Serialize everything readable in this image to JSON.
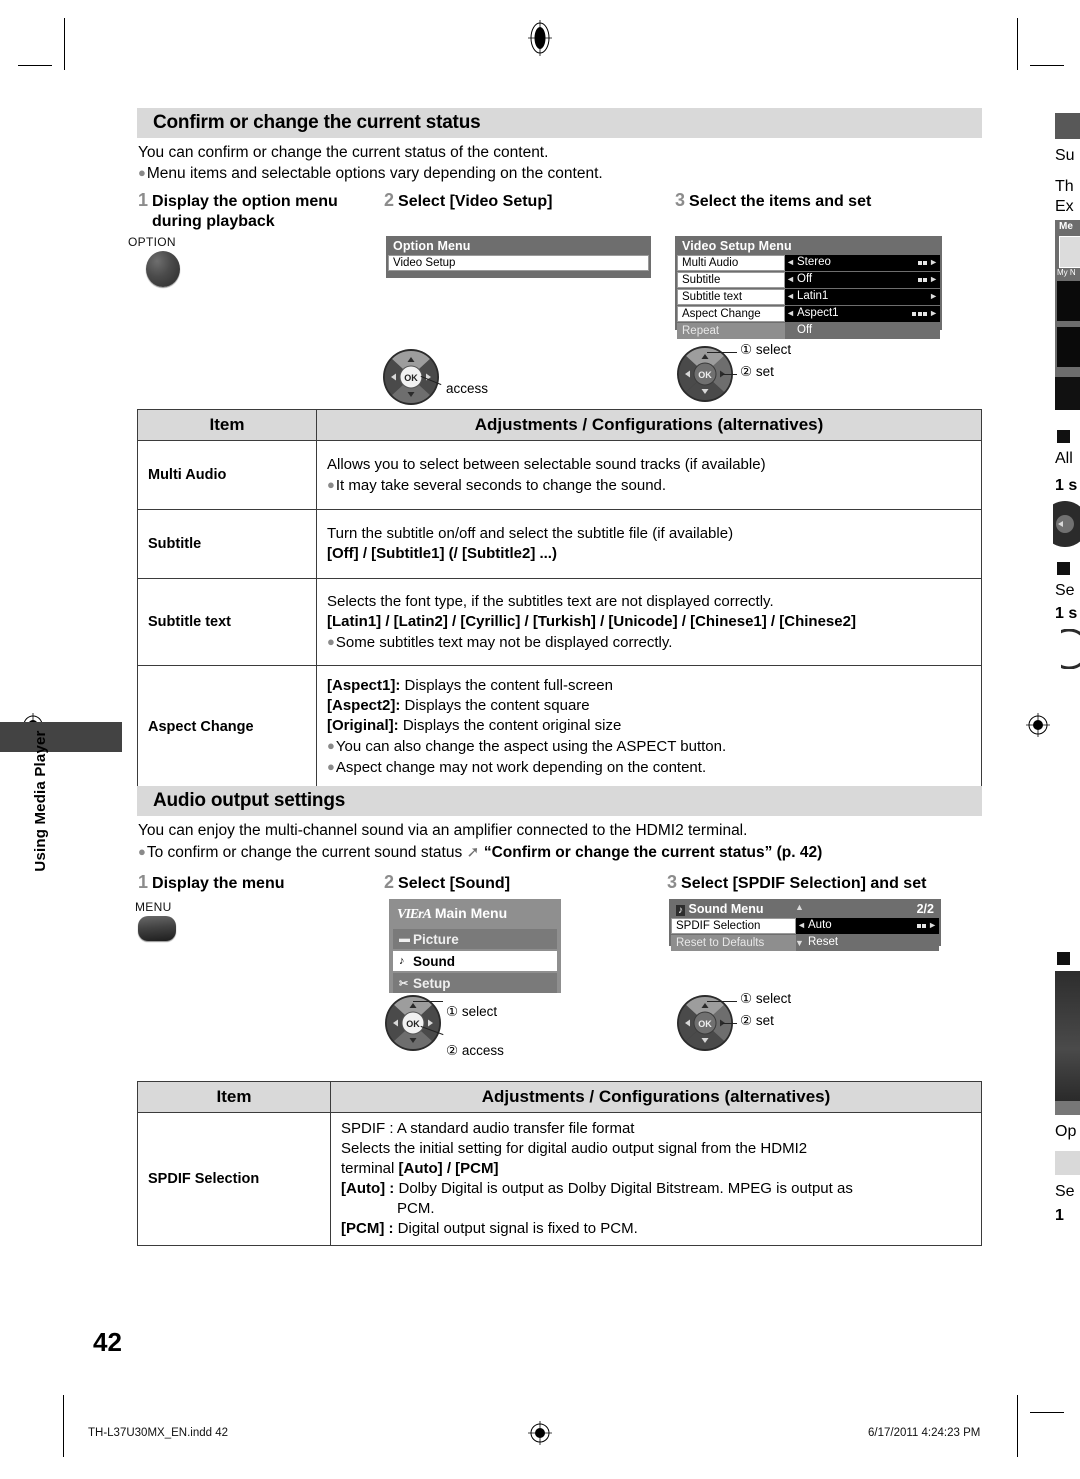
{
  "page": {
    "number": "42",
    "side_tab_label": "Using Media Player",
    "footer": {
      "file": "TH-L37U30MX_EN.indd   42",
      "timestamp": "6/17/2011   4:24:23 PM"
    }
  },
  "section1": {
    "heading": "Confirm or change the current status",
    "intro": "You can confirm or change the current status of the content.",
    "intro_bullet": "Menu items and selectable options vary depending on the content.",
    "steps": [
      {
        "num": "1",
        "line1": "Display the option menu",
        "line2": "during playback"
      },
      {
        "num": "2",
        "line1": "Select [Video Setup]",
        "line2": ""
      },
      {
        "num": "3",
        "line1": "Select the items and set",
        "line2": ""
      }
    ],
    "option_button_label": "OPTION",
    "option_menu": {
      "title": "Option Menu",
      "items": [
        "Video Setup"
      ]
    },
    "video_setup_menu": {
      "title": "Video Setup Menu",
      "rows": [
        {
          "label": "Multi Audio",
          "value": "Stereo",
          "level": 2,
          "dim": false
        },
        {
          "label": "Subtitle",
          "value": "Off",
          "level": 2,
          "dim": false
        },
        {
          "label": "Subtitle text",
          "value": "Latin1",
          "level": 0,
          "dim": false
        },
        {
          "label": "Aspect Change",
          "value": "Aspect1",
          "level": 3,
          "dim": false
        },
        {
          "label": "Repeat",
          "value": "Off",
          "level": 0,
          "dim": true
        }
      ]
    },
    "navpad_left_callouts": [
      "access"
    ],
    "navpad_right_callouts": [
      "① select",
      "② set"
    ]
  },
  "table1": {
    "headers": [
      "Item",
      "Adjustments / Configurations (alternatives)"
    ],
    "rows": [
      {
        "item": "Multi Audio",
        "lines": [
          {
            "text": "Allows you to select between selectable sound tracks (if available)",
            "bold": false,
            "bullet": false
          },
          {
            "text": "It may take several seconds to change the sound.",
            "bold": false,
            "bullet": true
          }
        ]
      },
      {
        "item": "Subtitle",
        "lines": [
          {
            "text": "Turn the subtitle on/off and select the subtitle file (if available)",
            "bold": false,
            "bullet": false
          },
          {
            "text": "[Off] / [Subtitle1] (/ [Subtitle2] ...)",
            "bold": true,
            "bullet": false
          }
        ]
      },
      {
        "item": "Subtitle text",
        "lines": [
          {
            "text": "Selects the font type, if the subtitles text are not displayed correctly.",
            "bold": false,
            "bullet": false
          },
          {
            "text": "[Latin1] / [Latin2] / [Cyrillic] / [Turkish] / [Unicode] / [Chinese1] / [Chinese2]",
            "bold": true,
            "bullet": false
          },
          {
            "text": "Some subtitles text may not be displayed correctly.",
            "bold": false,
            "bullet": true
          }
        ]
      },
      {
        "item": "Aspect Change",
        "lines": [
          {
            "text": "[Aspect1]: Displays the content full-screen",
            "bold": false,
            "bullet": false,
            "leadbold": "[Aspect1]:",
            "rest": " Displays the content full-screen"
          },
          {
            "text": "[Aspect2]: Displays the content square",
            "bold": false,
            "bullet": false,
            "leadbold": "[Aspect2]:",
            "rest": " Displays the content square"
          },
          {
            "text": "[Original]: Displays the content original size",
            "bold": false,
            "bullet": false,
            "leadbold": "[Original]:",
            "rest": " Displays the content original size"
          },
          {
            "text": "You can also change the aspect using the ASPECT button.",
            "bold": false,
            "bullet": true
          },
          {
            "text": "Aspect change may not work depending on the content.",
            "bold": false,
            "bullet": true
          }
        ]
      }
    ]
  },
  "section2": {
    "heading": "Audio output settings",
    "intro": "You can enjoy the multi-channel sound via an amplifier connected to the HDMI2 terminal.",
    "intro_bullet_pre": "To confirm or change the current sound status ",
    "intro_bullet_bold": "“Confirm or change the current status” (p. 42)",
    "steps": [
      {
        "num": "1",
        "line1": "Display the menu",
        "line2": ""
      },
      {
        "num": "2",
        "line1": "Select [Sound]",
        "line2": ""
      },
      {
        "num": "3",
        "line1": "Select [SPDIF Selection] and set",
        "line2": ""
      }
    ],
    "menu_button_label": "MENU",
    "viera_menu": {
      "logo": "VIErA",
      "title": "Main Menu",
      "items": [
        {
          "label": "Picture",
          "icon": "picture-icon",
          "selected": false
        },
        {
          "label": "Sound",
          "icon": "note-icon",
          "selected": true
        },
        {
          "label": "Setup",
          "icon": "wrench-icon",
          "selected": false
        }
      ]
    },
    "sound_menu": {
      "title": "Sound Menu",
      "page_indicator": "2/2",
      "rows": [
        {
          "label": "SPDIF Selection",
          "value": "Auto",
          "level": 2,
          "dim": false
        },
        {
          "label": "Reset to Defaults",
          "value": "Reset",
          "level": 0,
          "dim": true
        }
      ]
    },
    "navpad_left_callouts": [
      "① select",
      "② access"
    ],
    "navpad_right_callouts": [
      "① select",
      "② set"
    ]
  },
  "table2": {
    "headers": [
      "Item",
      "Adjustments / Configurations (alternatives)"
    ],
    "rows": [
      {
        "item": "SPDIF Selection",
        "lines": [
          {
            "text": "SPDIF : A standard audio transfer file format"
          },
          {
            "text": "Selects the initial setting for digital audio output signal from the HDMI2"
          },
          {
            "text": "terminal [Auto] / [PCM]",
            "leadplain": "terminal ",
            "boldtail": "[Auto] / [PCM]"
          },
          {
            "text": "[Auto] : Dolby Digital is output as Dolby Digital Bitstream. MPEG is output as",
            "leadbold": "[Auto] :",
            "rest": " Dolby Digital is output as Dolby Digital Bitstream. MPEG is output as"
          },
          {
            "text": "PCM.",
            "indent": true
          },
          {
            "text": "[PCM] : Digital output signal is fixed to PCM.",
            "leadbold": "[PCM] :",
            "rest": " Digital output signal is fixed to PCM."
          }
        ]
      }
    ]
  },
  "next_page_bleed": {
    "lines": [
      "Su",
      "Th",
      "Ex",
      "All",
      "Se",
      "Op",
      "Se"
    ],
    "steps": [
      "1 s",
      "1 s",
      "1 "
    ],
    "thumb_label": "My N",
    "media_title": "Me"
  },
  "colors": {
    "heading_bar": "#d9d9d9",
    "table_header": "#d9d9d9",
    "osd_frame": "#6e6e6e",
    "osd_value_bg": "#000000",
    "side_tab": "#434343",
    "step_number": "#8c8c8c"
  }
}
